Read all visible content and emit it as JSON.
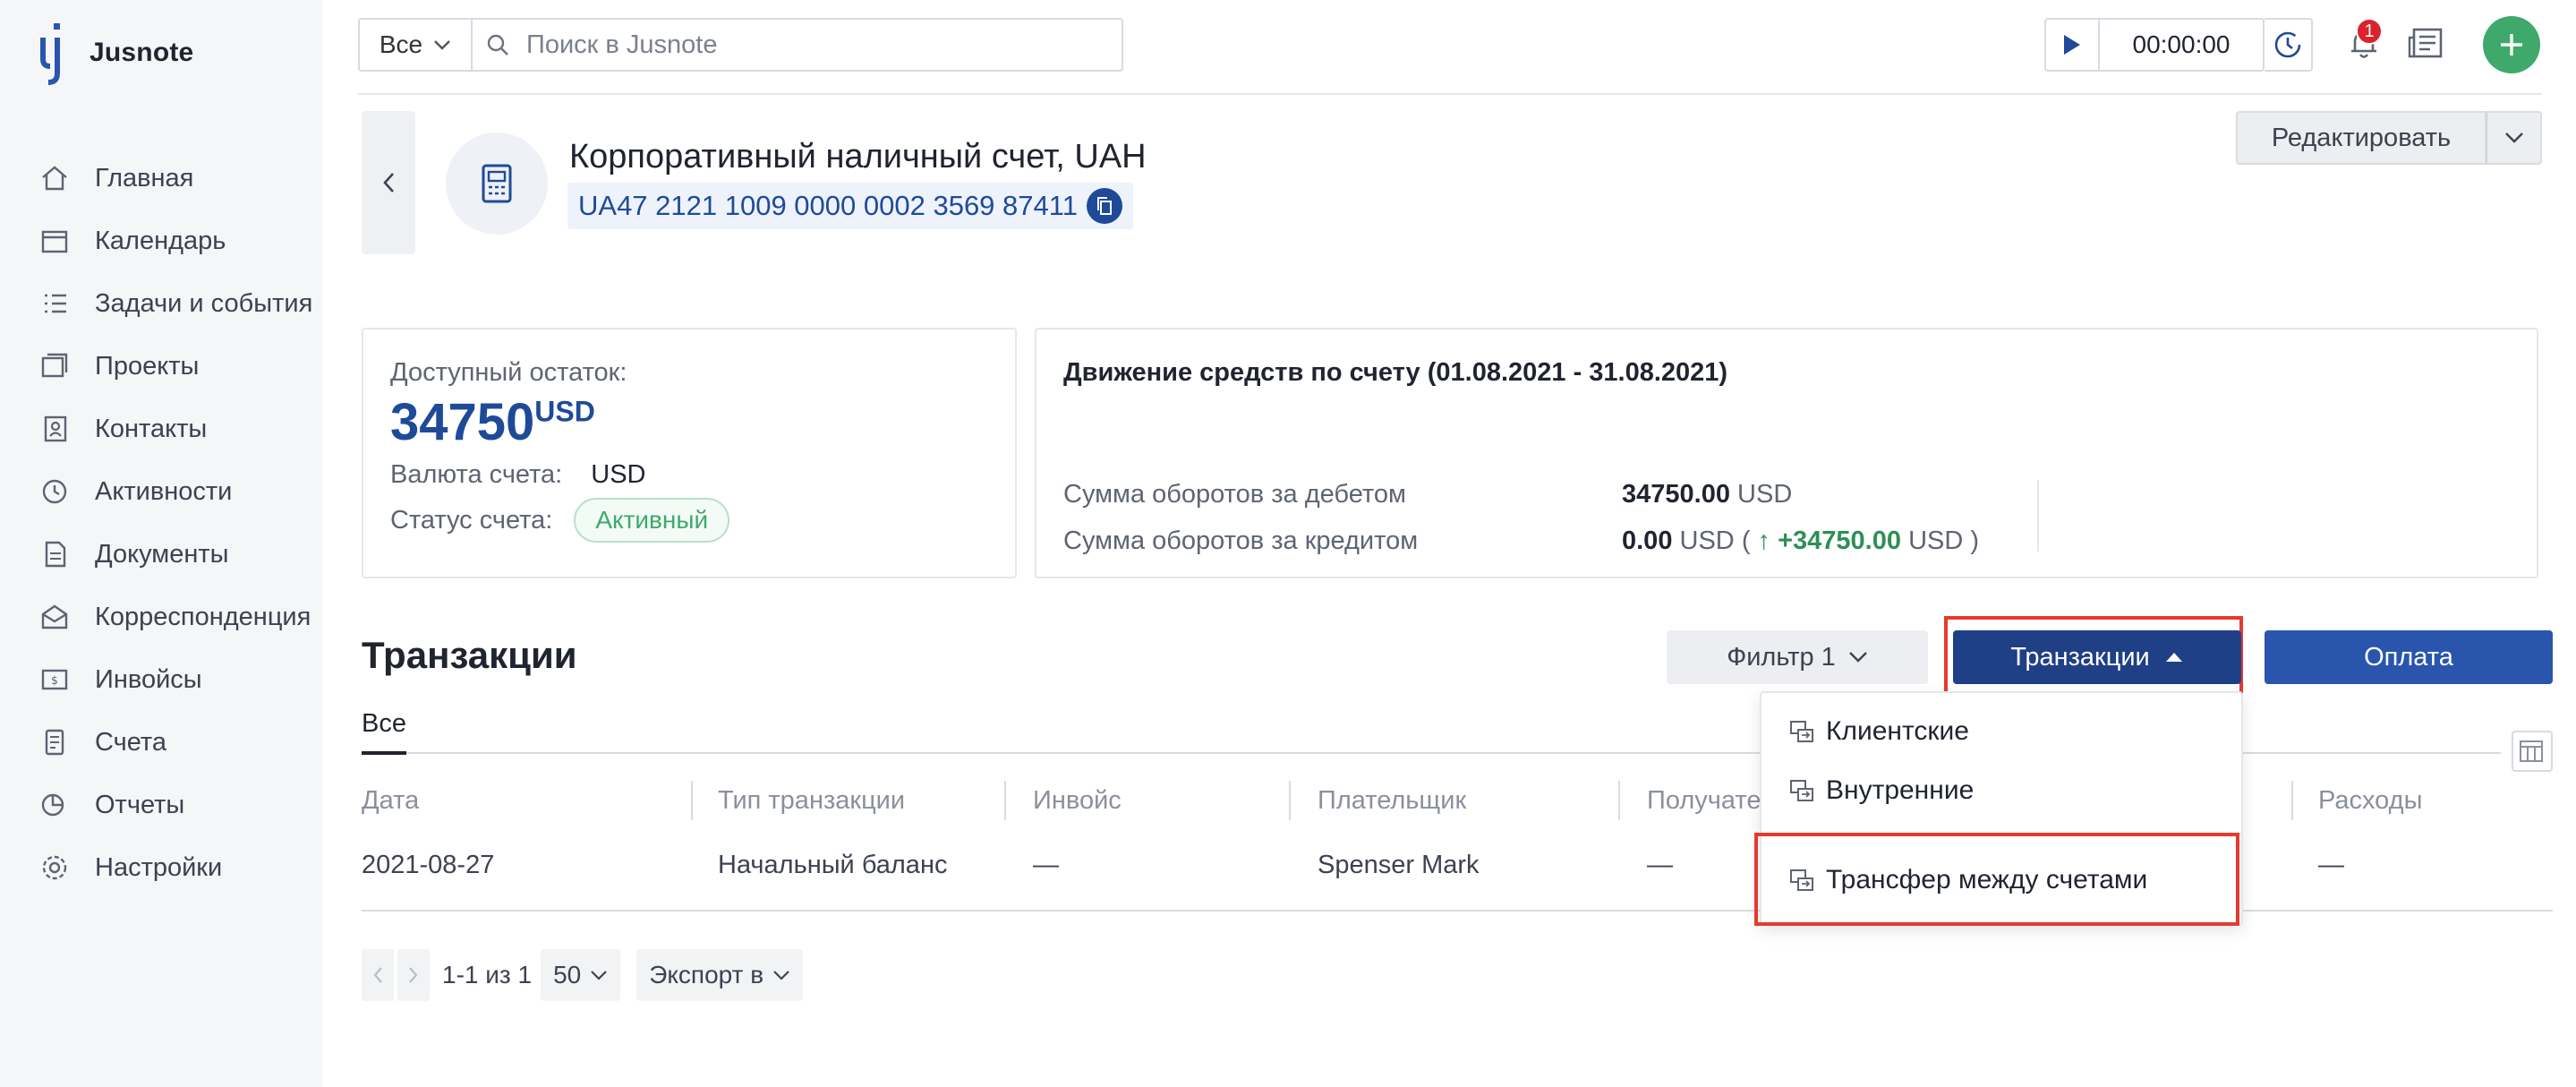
{
  "app": {
    "name": "Jusnote"
  },
  "sidebar": {
    "items": [
      {
        "label": "Главная",
        "icon": "home-icon"
      },
      {
        "label": "Календарь",
        "icon": "calendar-icon"
      },
      {
        "label": "Задачи и события",
        "icon": "tasks-icon"
      },
      {
        "label": "Проекты",
        "icon": "projects-icon"
      },
      {
        "label": "Контакты",
        "icon": "contacts-icon"
      },
      {
        "label": "Активности",
        "icon": "activity-icon"
      },
      {
        "label": "Документы",
        "icon": "documents-icon"
      },
      {
        "label": "Корреспонденция",
        "icon": "correspondence-icon"
      },
      {
        "label": "Инвойсы",
        "icon": "invoice-icon"
      },
      {
        "label": "Счета",
        "icon": "accounts-icon"
      },
      {
        "label": "Отчеты",
        "icon": "reports-icon"
      },
      {
        "label": "Настройки",
        "icon": "settings-icon"
      }
    ]
  },
  "topbar": {
    "scope": "Все",
    "search_placeholder": "Поиск в Jusnote",
    "timer": "00:00:00",
    "notifications_count": "1"
  },
  "account": {
    "title": "Корпоративный наличный счет, UAH",
    "iban": "UA47 2121 1009 0000 0002 3569 87411",
    "edit_label": "Редактировать"
  },
  "balance": {
    "label": "Доступный остаток:",
    "amount": "34750",
    "currency": "USD",
    "currency_label": "Валюта счета:",
    "currency_value": "USD",
    "status_label": "Статус счета:",
    "status_value": "Активный"
  },
  "movement": {
    "title": "Движение средств по счету (01.08.2021 - 31.08.2021)",
    "debit_label": "Сумма оборотов за дебетом",
    "debit_value": "34750.00",
    "debit_currency": "USD",
    "credit_label": "Сумма оборотов за кредитом",
    "credit_value": "0.00",
    "credit_currency": "USD",
    "open_paren": "(",
    "credit_delta": "+34750.00",
    "credit_delta_currency": "USD",
    "close_paren": ")"
  },
  "transactions": {
    "title": "Транзакции",
    "filter_label": "Фильтр 1",
    "transactions_button": "Транзакции",
    "pay_button": "Оплата",
    "tab_all": "Все",
    "columns": [
      "Дата",
      "Тип транзакции",
      "Инвойс",
      "Плательщик",
      "Получате",
      "Расходы"
    ],
    "rows": [
      {
        "date": "2021-08-27",
        "type": "Начальный баланс",
        "invoice": "—",
        "payer": "Spenser Mark",
        "receiver": "—",
        "expenses": "—"
      }
    ],
    "dropdown": [
      "Клиентские",
      "Внутренние",
      "Трансфер между счетами"
    ]
  },
  "pagination": {
    "range": "1-1 из 1",
    "page_size": "50",
    "export_label": "Экспорт в"
  },
  "colors": {
    "accent": "#1f3f86",
    "primary": "#2a55ad",
    "success": "#3ea96a",
    "highlight": "#e53a2f"
  }
}
